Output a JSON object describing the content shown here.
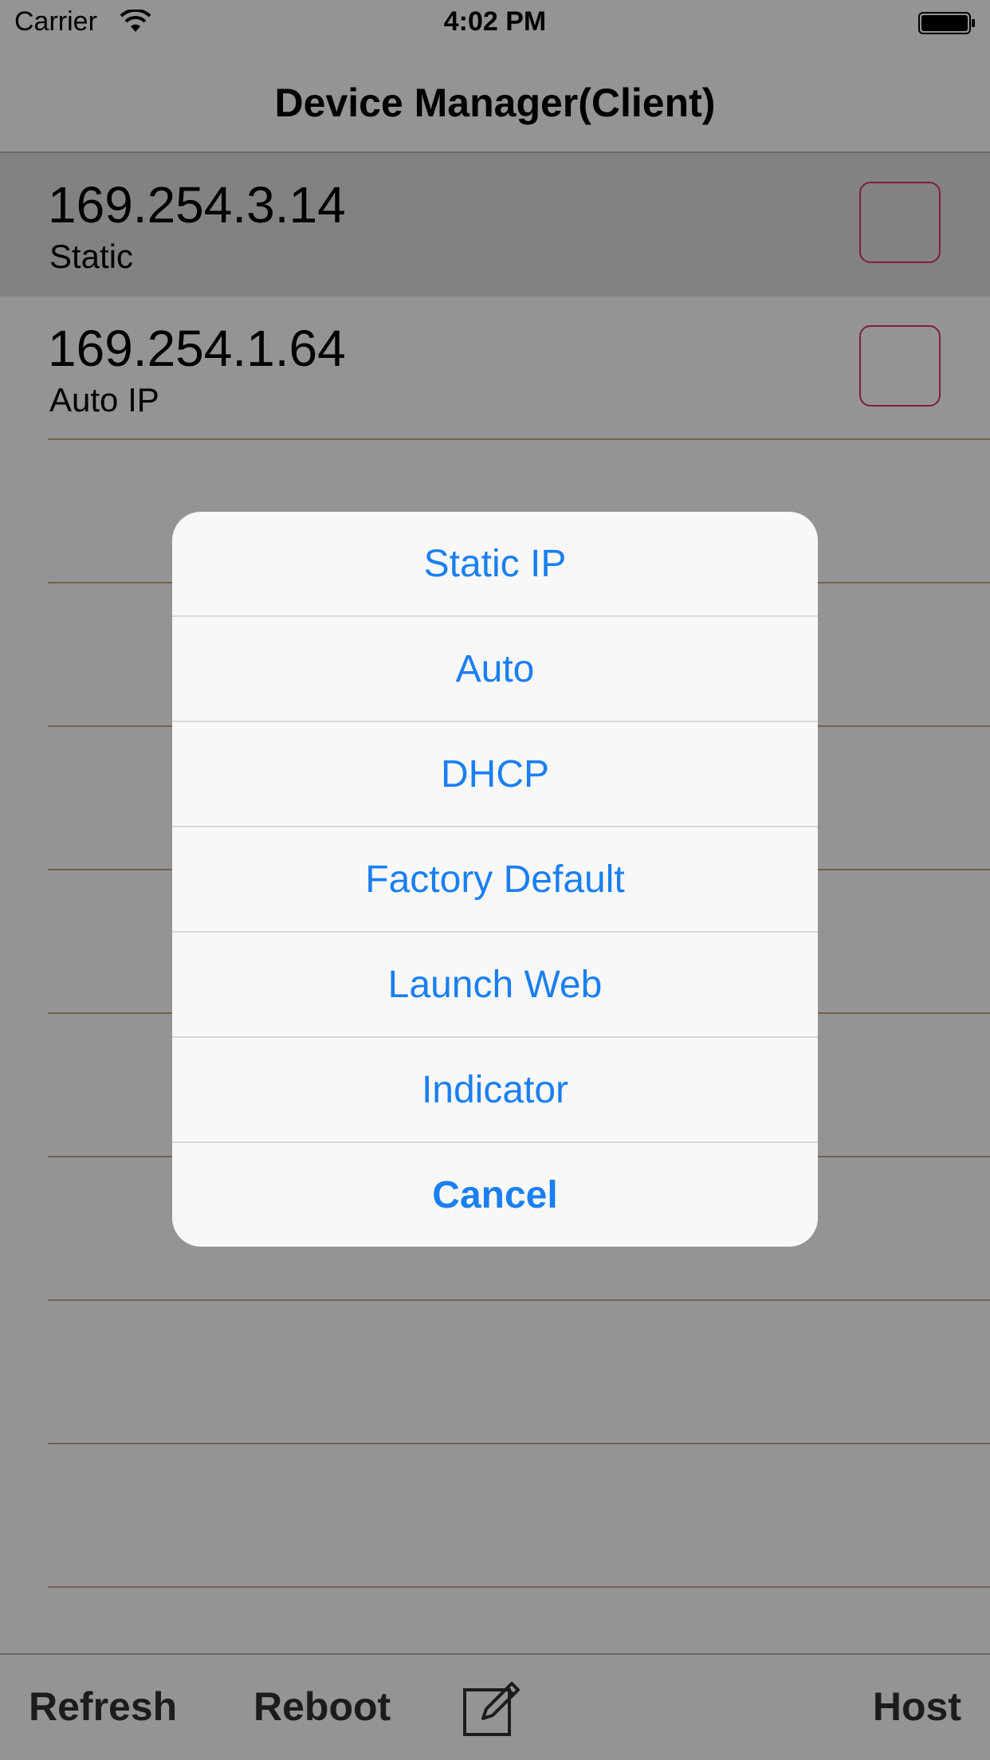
{
  "status_bar": {
    "carrier": "Carrier",
    "time": "4:02 PM"
  },
  "nav": {
    "title": "Device Manager(Client)"
  },
  "devices": [
    {
      "ip": "169.254.3.14",
      "mode": "Static",
      "selected": true
    },
    {
      "ip": "169.254.1.64",
      "mode": "Auto IP",
      "selected": false
    }
  ],
  "toolbar": {
    "refresh_label": "Refresh",
    "reboot_label": "Reboot",
    "edit_icon": "compose-icon",
    "host_label": "Host"
  },
  "action_sheet": {
    "options": [
      "Static IP",
      "Auto",
      "DHCP",
      "Factory Default",
      "Launch Web",
      "Indicator"
    ],
    "cancel_label": "Cancel"
  },
  "colors": {
    "accent": "#1a7ff0",
    "checkbox_border": "#d6336e",
    "separator": "#c2a27e"
  }
}
